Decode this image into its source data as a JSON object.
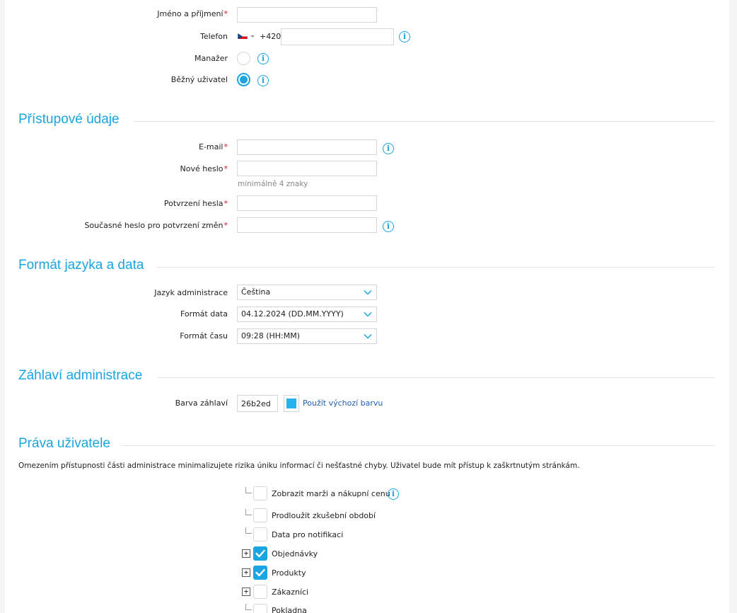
{
  "personal": {
    "name_label": "Jméno a příjmení",
    "phone_label": "Telefon",
    "phone_prefix": "+420",
    "phone_value": "",
    "name_value": "",
    "manager_label": "Manažer",
    "regular_label": "Běžný uživatel",
    "required_mark": "*"
  },
  "access": {
    "title": "Přístupové údaje",
    "email_label": "E-mail",
    "new_password_label": "Nové heslo",
    "password_hint": "minimálně 4 znaky",
    "confirm_label": "Potvrzení hesla",
    "current_label": "Současné heslo pro potvrzení změn"
  },
  "format": {
    "title": "Formát jazyka a data",
    "language_label": "Jazyk administrace",
    "language_value": "Čeština",
    "date_label": "Formát data",
    "date_value": "04.12.2024 (DD.MM.YYYY)",
    "time_label": "Formát času",
    "time_value": "09:28 (HH:MM)"
  },
  "header": {
    "title": "Záhlaví administrace",
    "color_label": "Barva záhlaví",
    "color_value": "26b2ed",
    "color_swatch": "#26b2ed",
    "default_link": "Použít výchozí barvu"
  },
  "rights": {
    "title": "Práva uživatele",
    "description": "Omezením přístupnosti části administrace minimalizujete rizika úniku informací či nešťastné chyby. Uživatel bude mít přístup k zaškrtnutým stránkám.",
    "items": [
      {
        "label": "Zobrazit marži a nákupní cenu",
        "checked": false,
        "kind": "child",
        "info": true
      },
      {
        "label": "Prodloužit zkušební období",
        "checked": false,
        "kind": "child"
      },
      {
        "label": "Data pro notifikaci",
        "checked": false,
        "kind": "child"
      },
      {
        "label": "Objednávky",
        "checked": true,
        "kind": "parent"
      },
      {
        "label": "Produkty",
        "checked": true,
        "kind": "parent"
      },
      {
        "label": "Zákazníci",
        "checked": false,
        "kind": "parent"
      },
      {
        "label": "Pokladna",
        "checked": false,
        "kind": "child"
      }
    ]
  },
  "colors": {
    "accent": "#1aa5e0",
    "required": "#e0102a",
    "link": "#1f5fb0"
  }
}
